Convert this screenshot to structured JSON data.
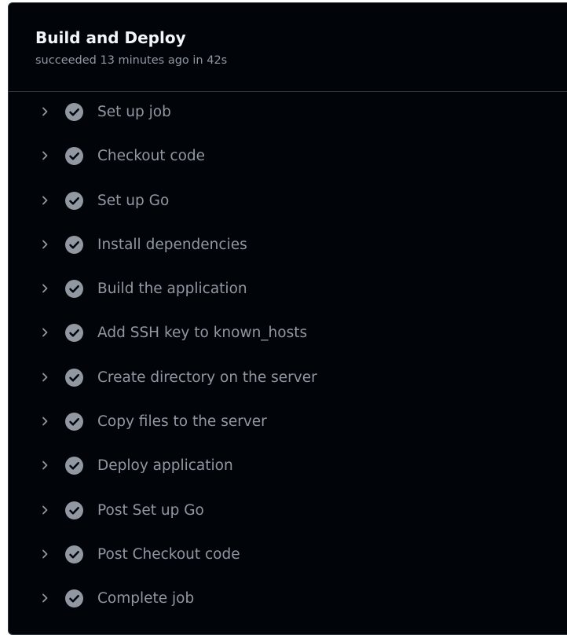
{
  "job": {
    "title": "Build and Deploy",
    "status": "succeeded 13 minutes ago in 42s"
  },
  "steps": [
    {
      "label": "Set up job",
      "status": "success"
    },
    {
      "label": "Checkout code",
      "status": "success"
    },
    {
      "label": "Set up Go",
      "status": "success"
    },
    {
      "label": "Install dependencies",
      "status": "success"
    },
    {
      "label": "Build the application",
      "status": "success"
    },
    {
      "label": "Add SSH key to known_hosts",
      "status": "success"
    },
    {
      "label": "Create directory on the server",
      "status": "success"
    },
    {
      "label": "Copy files to the server",
      "status": "success"
    },
    {
      "label": "Deploy application",
      "status": "success"
    },
    {
      "label": "Post Set up Go",
      "status": "success"
    },
    {
      "label": "Post Checkout code",
      "status": "success"
    },
    {
      "label": "Complete job",
      "status": "success"
    }
  ],
  "icons": {
    "expand": "chevron-right-icon",
    "status": "check-circle-icon"
  },
  "colors": {
    "background": "#010409",
    "border": "#30363d",
    "title": "#f0f6fc",
    "muted": "#9198a1",
    "check_fill": "#9198a1",
    "check_mark": "#010409"
  }
}
